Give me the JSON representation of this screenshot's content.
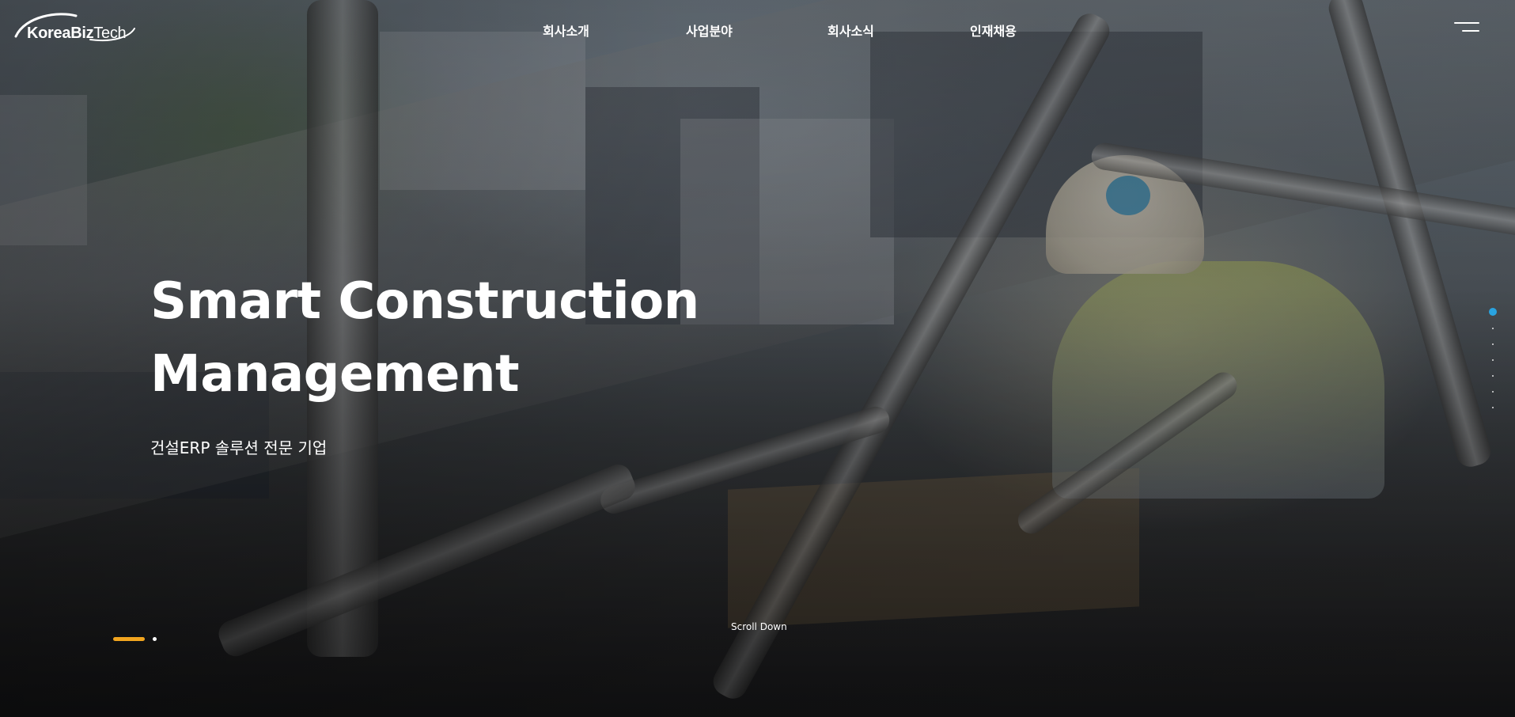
{
  "brand": {
    "name_bold": "KoreaBiz",
    "name_light": "Tech"
  },
  "nav": {
    "items": [
      {
        "label": "회사소개"
      },
      {
        "label": "사업분야"
      },
      {
        "label": "회사소식"
      },
      {
        "label": "인재채용"
      }
    ],
    "menu_icon": "hamburger-menu-icon"
  },
  "hero": {
    "title_line1": "Smart Construction",
    "title_line2": "Management",
    "subtitle": "건설ERP 솔루션 전문 기업",
    "scroll_label": "Scroll Down"
  },
  "slider": {
    "total_slides": 2,
    "active_slide": 1
  },
  "section_pager": {
    "total_sections": 7,
    "active_section": 1
  },
  "colors": {
    "accent_orange": "#f2a51f",
    "accent_blue": "#29a3e0",
    "text": "#ffffff"
  }
}
